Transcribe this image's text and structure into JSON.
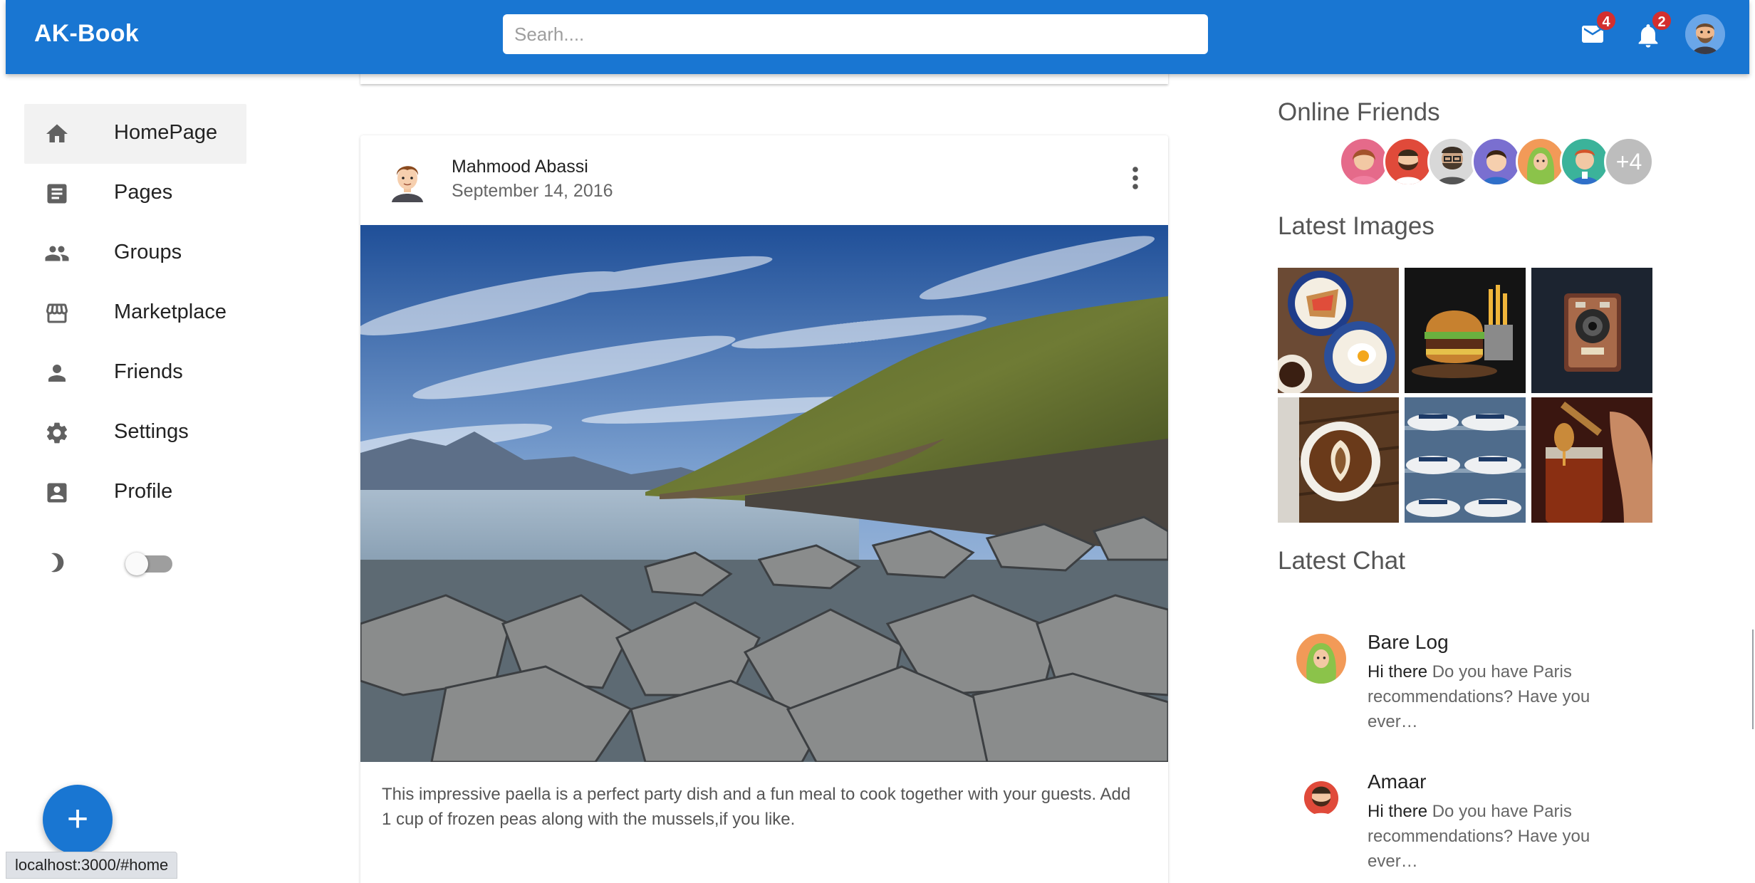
{
  "app": {
    "title": "AK-Book"
  },
  "search": {
    "placeholder": "Searh...."
  },
  "header": {
    "mail_icon": "mail-icon",
    "mail_count": "4",
    "notifications_icon": "bell-icon",
    "notifications_count": "2",
    "avatar_icon": "user-avatar"
  },
  "sidebar": {
    "items": [
      {
        "label": "HomePage",
        "icon": "home-icon",
        "active": true
      },
      {
        "label": "Pages",
        "icon": "article-icon"
      },
      {
        "label": "Groups",
        "icon": "group-icon"
      },
      {
        "label": "Marketplace",
        "icon": "storefront-icon"
      },
      {
        "label": "Friends",
        "icon": "person-icon"
      },
      {
        "label": "Settings",
        "icon": "gear-icon"
      },
      {
        "label": "Profile",
        "icon": "account-box-icon"
      }
    ],
    "theme_icon": "half-moon-icon",
    "dark_mode": false,
    "fab_label": "+"
  },
  "post": {
    "author": "Mahmood Abassi",
    "date": "September 14, 2016",
    "text": "This impressive paella is a perfect party dish and a fun meal to cook together with your guests. Add 1 cup of frozen peas along with the mussels,if you like.",
    "image_icon": "coastal-landscape-photo"
  },
  "rightbar": {
    "online_title": "Online Friends",
    "online_more": "+4",
    "images_title": "Latest Images",
    "images": [
      "breakfast-photo",
      "burger-photo",
      "camera-photo",
      "latte-photo",
      "hats-photo",
      "honey-photo"
    ],
    "chat_title": "Latest Chat",
    "chats": [
      {
        "name": "Bare Log",
        "lead": "Hi there",
        "message": " Do you have Paris recommendations? Have you ever…"
      },
      {
        "name": "Amaar",
        "lead": "Hi there",
        "message": " Do you have Paris recommendations? Have you ever…"
      }
    ]
  },
  "status_url": "localhost:3000/#home",
  "colors": {
    "primary": "#1976d2",
    "badge": "#d32f2f"
  }
}
